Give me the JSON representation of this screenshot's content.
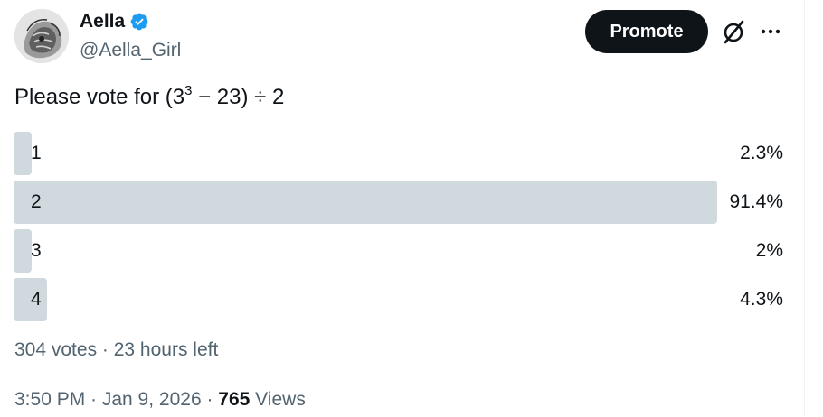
{
  "author": {
    "display_name": "Aella",
    "handle": "@Aella_Girl"
  },
  "actions": {
    "promote_label": "Promote"
  },
  "tweet": {
    "text_before_sup": "Please vote for (3",
    "sup": "3",
    "text_after_sup": " − 23) ÷ 2"
  },
  "poll": {
    "options": [
      {
        "label": "1",
        "percent_text": "2.3%",
        "percent": 2.3
      },
      {
        "label": "2",
        "percent_text": "91.4%",
        "percent": 91.4
      },
      {
        "label": "3",
        "percent_text": "2%",
        "percent": 2
      },
      {
        "label": "4",
        "percent_text": "4.3%",
        "percent": 4.3
      }
    ],
    "meta": "304 votes · 23 hours left"
  },
  "footer": {
    "time_date": "3:50 PM · Jan 9, 2026 · ",
    "views_count": "765",
    "views_label": " Views"
  },
  "colors": {
    "poll_bar": "#cfd9de",
    "promote_bg": "#0f1419",
    "verified": "#1d9bf0",
    "secondary_text": "#536471"
  },
  "icons": {
    "verified": "verified-badge-icon",
    "grok": "grok-icon",
    "more": "more-dots-icon"
  }
}
